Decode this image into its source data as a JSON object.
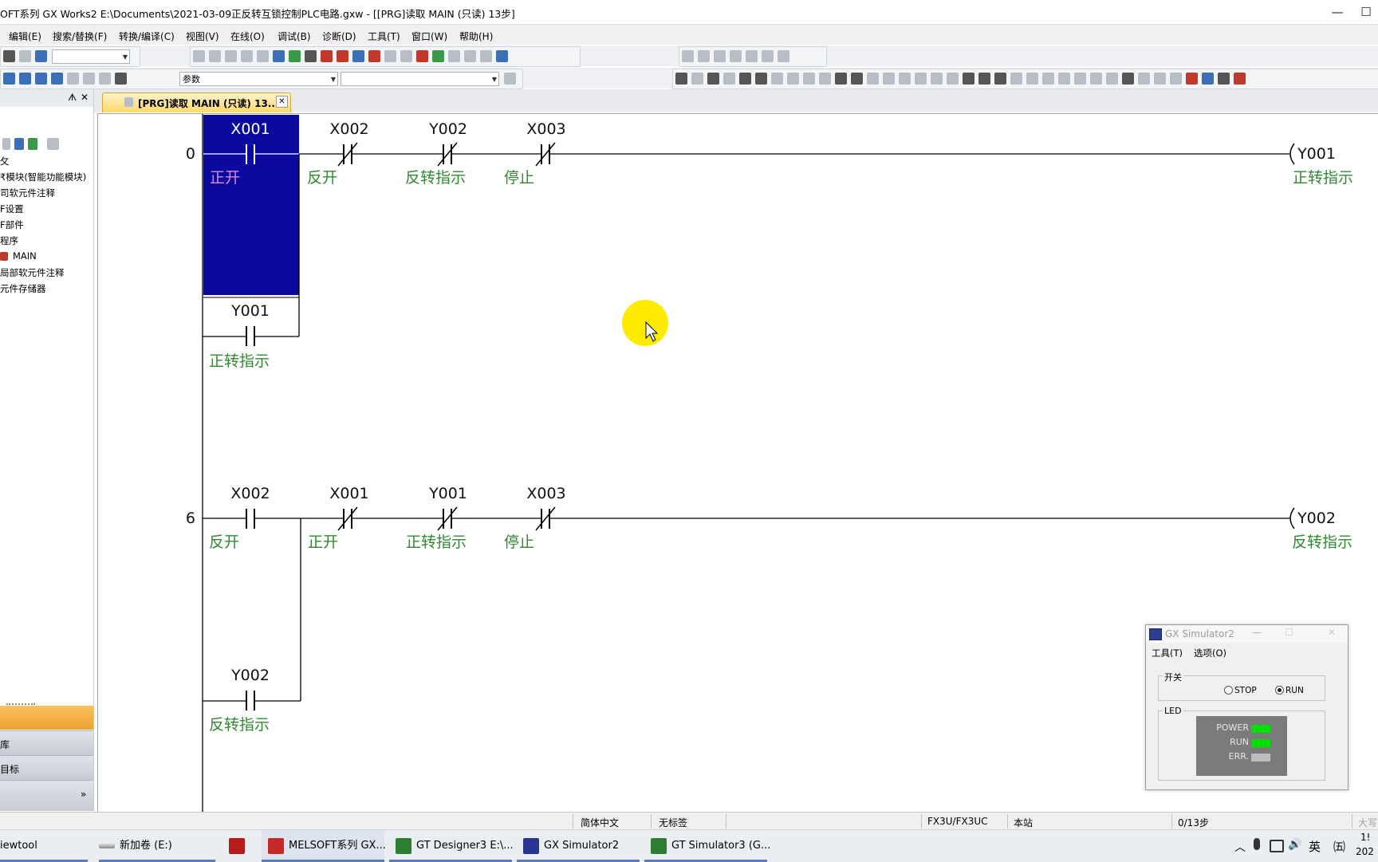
{
  "window": {
    "title": "OFT系列 GX Works2 E:\\Documents\\2021-03-09正反转互锁控制PLC电路.gxw - [[PRG]读取 MAIN (只读) 13步]",
    "min_glyph": "—",
    "max_glyph": "☐"
  },
  "menu": [
    "编辑(E)",
    "搜索/替换(F)",
    "转换/编译(C)",
    "视图(V)",
    "在线(O)",
    "调试(B)",
    "诊断(D)",
    "工具(T)",
    "窗口(W)",
    "帮助(H)"
  ],
  "toolbar": {
    "combo_param": "参数"
  },
  "nav": {
    "pin_glyph": "ᗑ",
    "close_glyph": "✕",
    "tree": [
      "攵",
      "₹模块(智能功能模块)",
      "司软元件注释",
      "F设置",
      "F部件",
      "程序",
      "MAIN",
      "局部软元件注释",
      "元件存储器"
    ],
    "bottom_buttons": [
      "库",
      "目标"
    ],
    "expand_glyph": "»"
  },
  "tab": {
    "label": "[PRG]读取 MAIN (只读) 13...",
    "close_glyph": "✕"
  },
  "ladder": {
    "rung1": {
      "step": "0",
      "contacts": [
        {
          "device": "X001",
          "comment": "正开",
          "type": "NO"
        },
        {
          "device": "X002",
          "comment": "反开",
          "type": "NC"
        },
        {
          "device": "Y002",
          "comment": "反转指示",
          "type": "NC"
        },
        {
          "device": "X003",
          "comment": "停止",
          "type": "NC"
        }
      ],
      "branch": {
        "device": "Y001",
        "comment": "正转指示"
      },
      "coil": {
        "device": "Y001",
        "comment": "正转指示"
      }
    },
    "rung2": {
      "step": "6",
      "contacts": [
        {
          "device": "X002",
          "comment": "反开",
          "type": "NO"
        },
        {
          "device": "X001",
          "comment": "正开",
          "type": "NC"
        },
        {
          "device": "Y001",
          "comment": "正转指示",
          "type": "NC"
        },
        {
          "device": "X003",
          "comment": "停止",
          "type": "NC"
        }
      ],
      "branch": {
        "device": "Y002",
        "comment": "反转指示"
      },
      "coil": {
        "device": "Y002",
        "comment": "反转指示"
      }
    }
  },
  "simulator": {
    "title": "GX Simulator2",
    "menu": [
      "工具(T)",
      "选项(O)"
    ],
    "switch_group": "开关",
    "stop_label": "STOP",
    "run_label": "RUN",
    "mode": "RUN",
    "led_group": "LED",
    "leds": [
      {
        "label": "POWER",
        "color": "#00e000"
      },
      {
        "label": "RUN",
        "color": "#00e000"
      },
      {
        "label": "ERR.",
        "color": "#bdbdbd"
      }
    ]
  },
  "statusbar": {
    "language": "简体中文",
    "label": "无标签",
    "cpu": "FX3U/FX3UC",
    "station": "本站",
    "steps": "0/13步",
    "caps": "大写"
  },
  "taskbar": {
    "items": [
      "iewtool",
      "新加卷 (E:)",
      "",
      "MELSOFT系列 GX...",
      "GT Designer3 E:\\...",
      "GX Simulator2",
      "GT Simulator3 (G..."
    ],
    "tray_ime": "英",
    "tray_ime2": "㈤",
    "clock_time": "1!",
    "clock_date": "202"
  },
  "colors": {
    "selection": "#0a0a9e",
    "comment": "#2f8a2f",
    "cursor_highlight": "#ffeb00"
  }
}
